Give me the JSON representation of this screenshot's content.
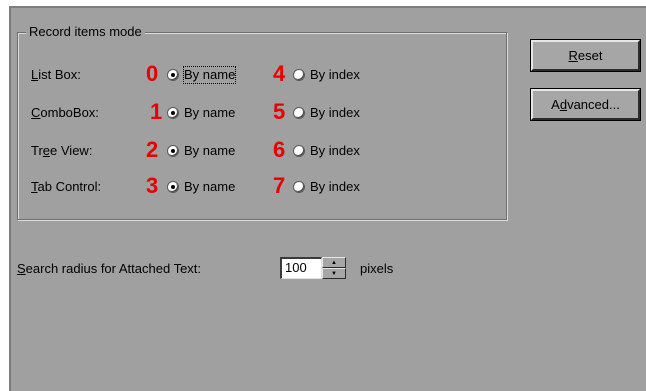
{
  "group": {
    "title": "Record items mode",
    "rows": [
      {
        "label_prefix": "",
        "label_mnemonic": "L",
        "label_rest": "ist Box:",
        "name_num": "0",
        "name_label": "By name",
        "index_num": "4",
        "index_label": "By index",
        "selected": "name"
      },
      {
        "label_prefix": "",
        "label_mnemonic": "C",
        "label_rest": "omboBox:",
        "name_num": "1",
        "name_label": "By name",
        "index_num": "5",
        "index_label": "By index",
        "selected": "name"
      },
      {
        "label_prefix": "Tr",
        "label_mnemonic": "e",
        "label_rest": "e View:",
        "name_num": "2",
        "name_label": "By name",
        "index_num": "6",
        "index_label": "By index",
        "selected": "name"
      },
      {
        "label_prefix": "",
        "label_mnemonic": "T",
        "label_rest": "ab Control:",
        "name_num": "3",
        "name_label": "By name",
        "index_num": "7",
        "index_label": "By index",
        "selected": "name"
      }
    ]
  },
  "buttons": {
    "reset_mnemonic": "R",
    "reset_rest": "eset",
    "advanced_prefix": "A",
    "advanced_mnemonic": "d",
    "advanced_rest": "vanced..."
  },
  "search": {
    "label_mnemonic": "S",
    "label_rest": "earch radius for Attached Text:",
    "value": "100",
    "unit": "pixels"
  },
  "colors": {
    "panel": "#a0a0a0",
    "annotation": "#e60000"
  }
}
